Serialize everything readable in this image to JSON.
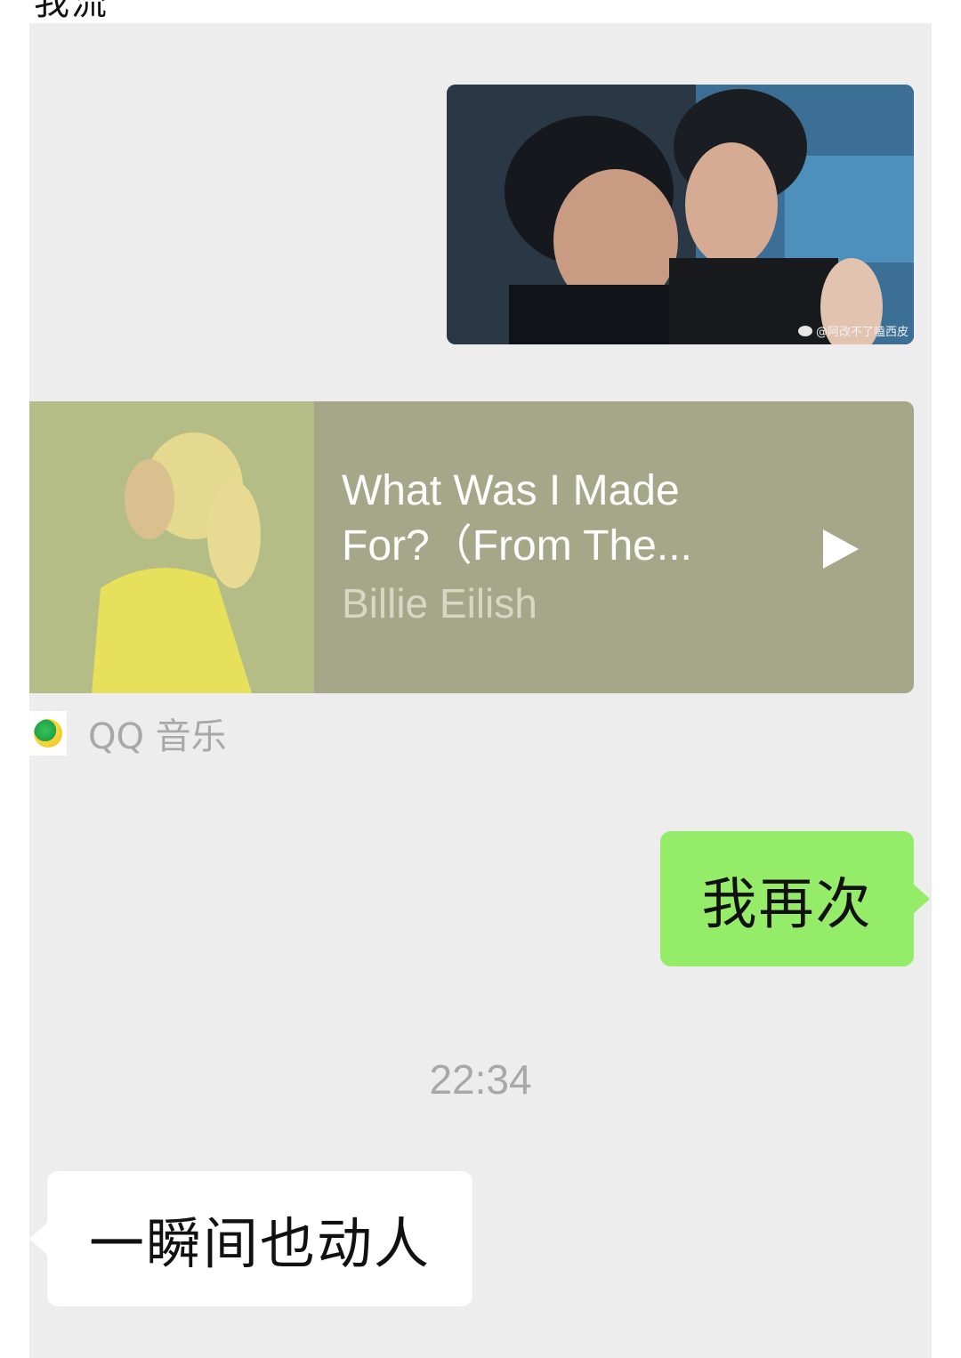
{
  "top_partial_text": "我流",
  "photo_message": {
    "watermark": "@阿改不了嗑西皮",
    "watermark_icon": "weibo-icon"
  },
  "music_card": {
    "title": "What Was I Made For?（From The...",
    "artist": "Billie Eilish",
    "play_icon": "play-icon",
    "source_label": "QQ 音乐",
    "source_icon": "qq-music-logo",
    "card_color": "#a5a888"
  },
  "sent_message": {
    "text": "我再次",
    "bubble_color": "#95ec69"
  },
  "timestamp": "22:34",
  "received_message": {
    "text": "一瞬间也动人",
    "bubble_color": "#ffffff"
  },
  "colors": {
    "chat_background": "#ededed"
  }
}
